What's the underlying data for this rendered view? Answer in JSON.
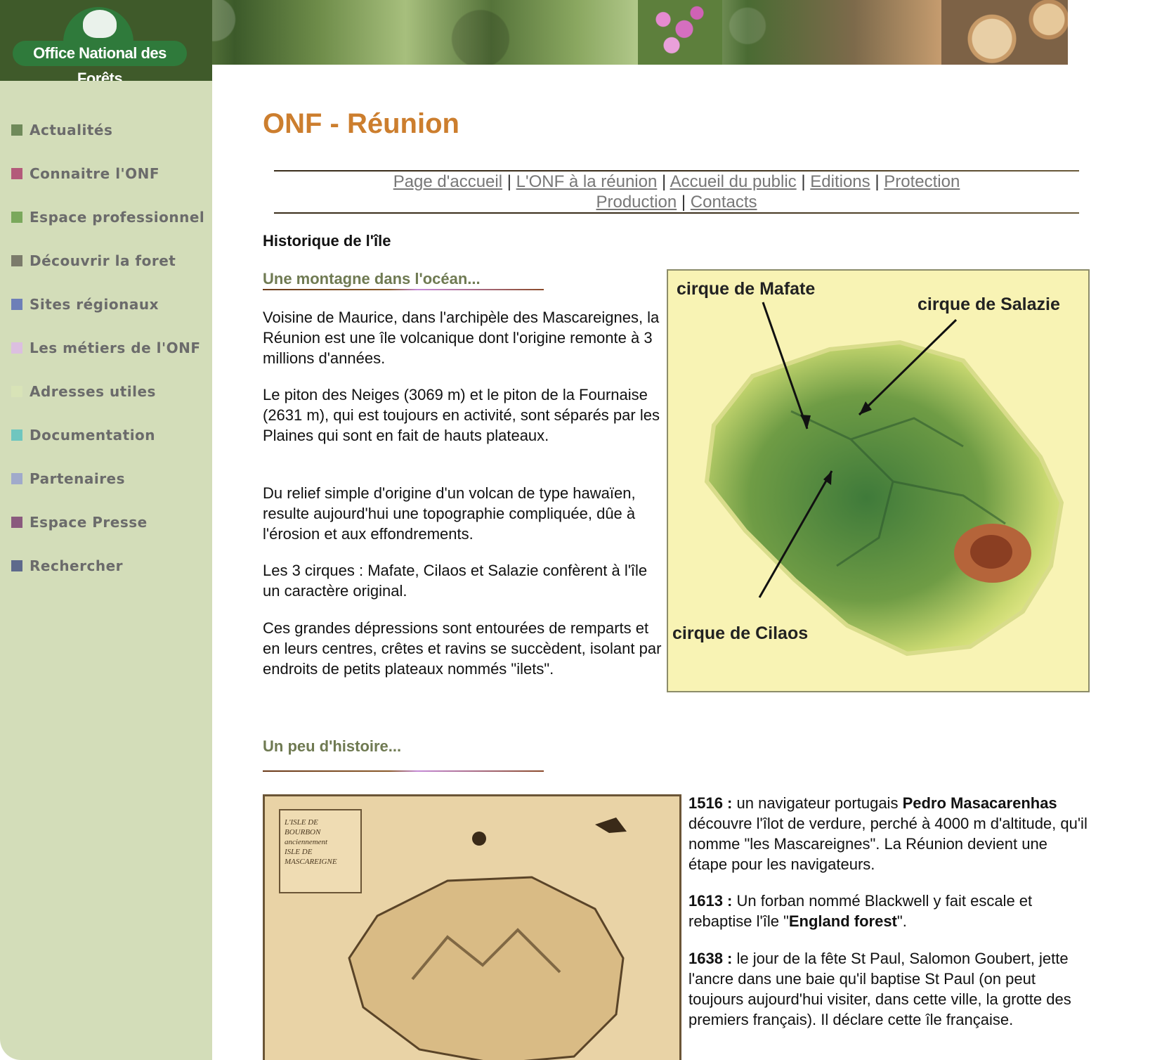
{
  "brand": {
    "logo_text": "Office National des Forêts"
  },
  "sidebar": {
    "items": [
      {
        "label": "Actualités",
        "color": "#6f8a5a"
      },
      {
        "label": "Connaitre l'ONF",
        "color": "#b35a7a"
      },
      {
        "label": "Espace professionnel",
        "color": "#7aa85c"
      },
      {
        "label": "Découvrir la foret",
        "color": "#7b7b6b"
      },
      {
        "label": "Sites régionaux",
        "color": "#6d7fb8"
      },
      {
        "label": "Les métiers de l'ONF",
        "color": "#dcbfe0"
      },
      {
        "label": "Adresses utiles",
        "color": "#d8e3b7"
      },
      {
        "label": "Documentation",
        "color": "#6fc6bf"
      },
      {
        "label": "Partenaires",
        "color": "#a0aacb"
      },
      {
        "label": "Espace Presse",
        "color": "#8a5a7e"
      },
      {
        "label": "Rechercher",
        "color": "#5e6a8c"
      }
    ]
  },
  "page": {
    "title": "ONF - Réunion",
    "section_heading": "Historique de l'île"
  },
  "topnav": {
    "links": [
      "Page d'accueil",
      "L'ONF à la réunion",
      "Accueil du public",
      "Editions",
      "Protection",
      "Production",
      "Contacts"
    ],
    "separator": "|"
  },
  "section1": {
    "heading": "Une montagne dans l'océan...",
    "paragraphs": [
      "Voisine de Maurice, dans l'archipèle des Mascareignes, la Réunion est une île volcanique dont l'origine remonte à 3 millions d'années.",
      "Le piton des Neiges (3069 m) et le piton de la Fournaise (2631 m), qui est toujours en activité, sont séparés par les Plaines qui sont en fait de hauts plateaux.",
      "Du relief simple d'origine d'un volcan de type hawaïen, resulte aujourd'hui une topographie compliquée, dûe à l'érosion et aux effondrements.",
      "Les 3 cirques : Mafate, Cilaos et Salazie confèrent à l'île un caractère original.",
      "Ces grandes dépressions sont entourées de remparts et en leurs centres, crêtes et ravins se succèdent, isolant par endroits de petits plateaux nommés \"ilets\"."
    ]
  },
  "map": {
    "labels": [
      "cirque de Mafate",
      "cirque de Salazie",
      "cirque de Cilaos"
    ]
  },
  "section2": {
    "heading": "Un peu d'histoire..."
  },
  "oldmap": {
    "cartouche_lines": [
      "L'ISLE DE",
      "BOURBON",
      "anciennement",
      "ISLE DE",
      "MASCAREIGNE"
    ]
  },
  "timeline": [
    {
      "year": "1516 :",
      "pre": " un navigateur portugais ",
      "bold": "Pedro Masacarenhas",
      "post": " découvre l'îlot de verdure, perché à 4000 m d'altitude, qu'il nomme \"les Mascareignes\". La Réunion devient une étape pour les navigateurs."
    },
    {
      "year": "1613 :",
      "pre": " Un forban nommé Blackwell y fait escale et rebaptise l'île \"",
      "bold": "England forest",
      "post": "\"."
    },
    {
      "year": "1638 :",
      "pre": " le jour de la fête St Paul, Salomon Goubert, jette l'ancre dans une baie qu'il baptise St Paul (on peut toujours aujourd'hui visiter, dans cette ville, la grotte des premiers français). Il déclare cette île française.",
      "bold": "",
      "post": ""
    }
  ]
}
